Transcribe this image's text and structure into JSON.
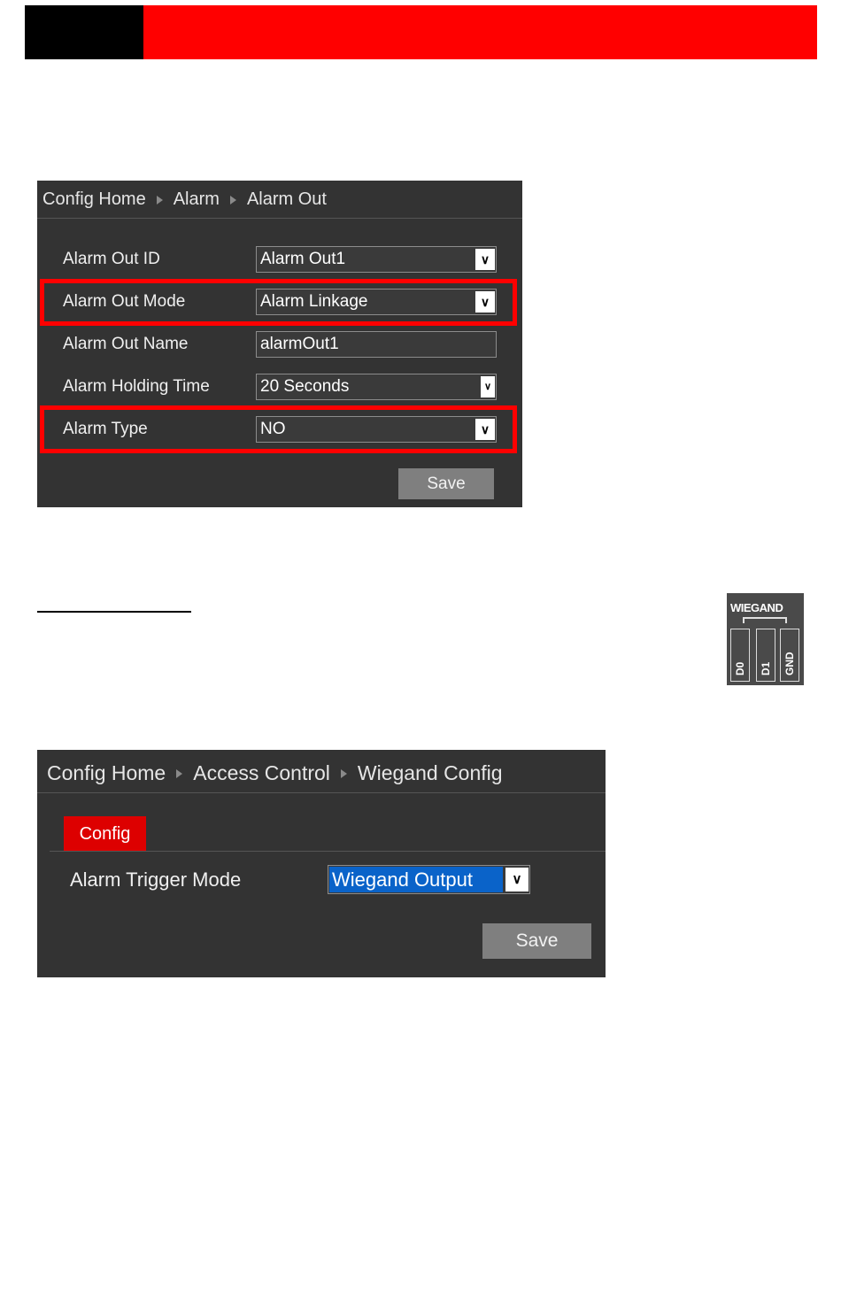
{
  "panel1": {
    "breadcrumb": [
      "Config Home",
      "Alarm",
      "Alarm Out"
    ],
    "rows": [
      {
        "label": "Alarm Out ID",
        "value": "Alarm Out1",
        "type": "select"
      },
      {
        "label": "Alarm Out Mode",
        "value": "Alarm Linkage",
        "type": "select",
        "highlighted": true
      },
      {
        "label": "Alarm Out Name",
        "value": "alarmOut1",
        "type": "text"
      },
      {
        "label": "Alarm Holding Time",
        "value": "20 Seconds",
        "type": "select"
      },
      {
        "label": "Alarm Type",
        "value": "NO",
        "type": "select",
        "highlighted": true
      }
    ],
    "save_label": "Save"
  },
  "wiegand_photo": {
    "title": "WIEGAND",
    "pins": [
      "D0",
      "D1",
      "GND"
    ]
  },
  "panel2": {
    "breadcrumb": [
      "Config Home",
      "Access Control",
      "Wiegand Config"
    ],
    "tab": "Config",
    "row": {
      "label": "Alarm Trigger Mode",
      "value": "Wiegand Output"
    },
    "save_label": "Save"
  },
  "colors": {
    "header_red": "#ff0000",
    "panel_bg": "#333333",
    "highlight_red": "#ff0000",
    "tab_red": "#dd0000",
    "selection_blue": "#0a63c9",
    "button_gray": "#7f7f7f"
  },
  "icons": [
    "chevron-down-icon",
    "breadcrumb-arrow-icon"
  ]
}
